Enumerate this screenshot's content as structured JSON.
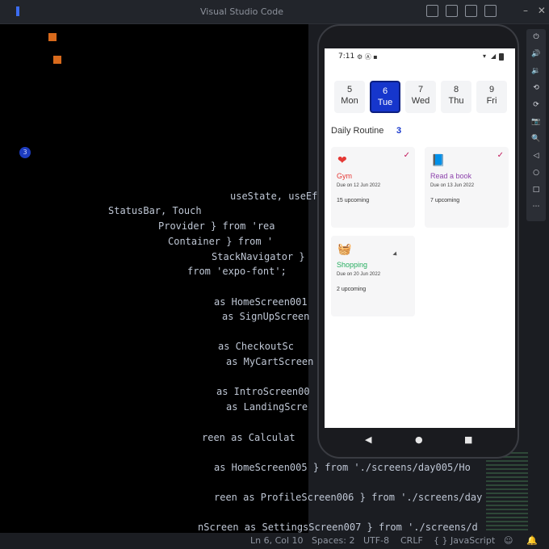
{
  "window": {
    "title": "Visual Studio Code",
    "controls": [
      "–",
      "✕"
    ]
  },
  "activity": {
    "badge": "3"
  },
  "code_lines": [
    {
      "pre": "",
      "main": "useState, useEffect }"
    },
    {
      "pre": "",
      "main": "StatusBar, Touch"
    },
    {
      "pre": "",
      "main": "Provider } from 'rea"
    },
    {
      "pre": "",
      "main": "Container } from '"
    },
    {
      "pre": "",
      "main": "StackNavigator }"
    },
    {
      "pre": "",
      "main": "from 'expo-font';"
    },
    {
      "pre": "",
      "main": "as HomeScreen001"
    },
    {
      "pre": "",
      "main": "as SignUpScreen"
    },
    {
      "pre": "",
      "main": "as CheckoutSc"
    },
    {
      "pre": "",
      "main": "as MyCartScreen"
    },
    {
      "pre": "",
      "main": "as IntroScreen00"
    },
    {
      "pre": "",
      "main": "as LandingScre"
    },
    {
      "pre": "",
      "main": "reen as Calculat"
    },
    {
      "pre": "",
      "main": "as HomeScreen005 } from './screens/day005/Ho"
    },
    {
      "pre": "",
      "main": "reen as ProfileScreen006 } from './screens/day"
    },
    {
      "pre": "",
      "main": "nScreen as SettingsScreen007 } from './screens/d"
    }
  ],
  "statusbar": {
    "position": "Ln 6, Col 10",
    "spaces": "Spaces: 2",
    "encoding": "UTF-8",
    "eol": "CRLF",
    "language": "{ } JavaScript"
  },
  "emulator": {
    "toolbar_icons": [
      "power-icon",
      "volume-up-icon",
      "volume-down-icon",
      "rotate-left-icon",
      "rotate-right-icon",
      "camera-icon",
      "zoom-icon",
      "back-icon",
      "home-icon",
      "overview-icon",
      "more-icon"
    ]
  },
  "phone": {
    "status": {
      "time": "7:11",
      "icons": "⚙ Ⓐ ▪"
    },
    "days": [
      {
        "num": "5",
        "weekday": "Mon",
        "selected": false
      },
      {
        "num": "6",
        "weekday": "Tue",
        "selected": true
      },
      {
        "num": "7",
        "weekday": "Wed",
        "selected": false
      },
      {
        "num": "8",
        "weekday": "Thu",
        "selected": false
      },
      {
        "num": "9",
        "weekday": "Fri",
        "selected": false
      }
    ],
    "routine": {
      "title": "Daily Routine",
      "count": "3"
    },
    "cards": [
      {
        "name": "Gym",
        "due": "Due on 12 Jun 2022",
        "upcoming": "15 upcoming",
        "color": "#e53935",
        "icon": "heart-pulse-icon",
        "checked": true
      },
      {
        "name": "Read a book",
        "due": "Due on 13 Jun 2022",
        "upcoming": "7 upcoming",
        "color": "#8e44ad",
        "icon": "book-icon",
        "checked": true
      },
      {
        "name": "Shopping",
        "due": "Due on 20 Jun 2022",
        "upcoming": "2 upcoming",
        "color": "#27ae60",
        "icon": "basket-icon",
        "checked": false
      }
    ]
  },
  "colors": {
    "accent": "#1636cc",
    "check": "#c2185b"
  }
}
